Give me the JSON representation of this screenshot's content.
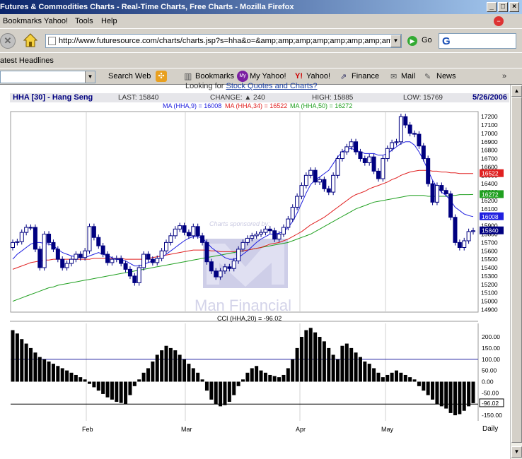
{
  "window": {
    "title": "Futures & Commodities Charts - Real-Time Charts, Free Charts - Mozilla Firefox",
    "buttons": [
      "_",
      "□",
      "×"
    ]
  },
  "menu": [
    "Bookmarks",
    "Yahoo!",
    "Tools",
    "Help"
  ],
  "nav": {
    "url": "http://www.futuresource.com/charts/charts.jsp?s=hha&o=&amp;amp;amp;amp;amp;amp;amp;amp;amp;a=D",
    "go_label": "Go",
    "search_logo": "G"
  },
  "headlines_label": "atest Headlines",
  "yahoo_toolbar": {
    "search_web": "Search Web",
    "bookmarks": "Bookmarks",
    "my_yahoo": "My Yahoo!",
    "yahoo": "Yahoo!",
    "finance": "Finance",
    "mail": "Mail",
    "news": "News"
  },
  "page": {
    "promo": "Looking for Stock Quotes and Charts?",
    "promo_link": "Stock Quotes and Charts?",
    "symbol": "HHA [30] - Hang Seng",
    "last": "LAST: 15840",
    "change": "CHANGE: ▲ 240",
    "high": "HIGH: 15885",
    "low": "LOW: 15769",
    "date": "5/26/2006",
    "ma_line": [
      "MA (HHA,9) = 16008",
      "MA (HHA,34) = 16522",
      "MA (HHA,50) = 16272"
    ],
    "cci_title": "CCI (HHA,20) = -96.02",
    "watermark_sponsor": "Charts sponsored by:",
    "watermark_brand": "Man Financial",
    "period": "Daily"
  },
  "colors": {
    "ma9": "#2020e0",
    "ma34": "#e02020",
    "ma50": "#20a020",
    "candle": "#000080",
    "cci": "#000000"
  },
  "chart_data": [
    {
      "type": "candlestick",
      "title": "HHA [30] - Hang Seng",
      "x_labels": [
        "Feb",
        "Mar",
        "Apr",
        "May"
      ],
      "y_ticks": [
        17200,
        17100,
        17000,
        16900,
        16800,
        16700,
        16600,
        16500,
        16400,
        16300,
        16200,
        16100,
        16000,
        15900,
        15800,
        15700,
        15600,
        15500,
        15400,
        15300,
        15200,
        15100,
        15000,
        14900
      ],
      "ylim": [
        14870,
        17260
      ],
      "price_tags": [
        {
          "name": "MA34",
          "value": 16522,
          "color": "#e02020"
        },
        {
          "name": "MA50",
          "value": 16272,
          "color": "#20a020"
        },
        {
          "name": "MA9",
          "value": 16008,
          "color": "#2020e0"
        },
        {
          "name": "Last",
          "value": 15840,
          "color": "#000080"
        }
      ],
      "closes": [
        15700,
        15710,
        15820,
        15880,
        15880,
        15620,
        15400,
        15800,
        15700,
        15620,
        15500,
        15400,
        15450,
        15500,
        15560,
        15520,
        15600,
        15890,
        15760,
        15660,
        15560,
        15460,
        15500,
        15510,
        15450,
        15380,
        15300,
        15220,
        15400,
        15560,
        15500,
        15460,
        15510,
        15600,
        15700,
        15780,
        15860,
        15900,
        15820,
        15780,
        15890,
        15780,
        15700,
        15470,
        15360,
        15290,
        15360,
        15410,
        15390,
        15480,
        15620,
        15700,
        15750,
        15780,
        15800,
        15820,
        15860,
        15840,
        15740,
        15800,
        15880,
        15980,
        16120,
        16250,
        16380,
        16500,
        16560,
        16420,
        16450,
        16340,
        16300,
        16500,
        16700,
        16780,
        16840,
        16900,
        16780,
        16700,
        16650,
        16720,
        16550,
        16460,
        16700,
        16820,
        16890,
        16900,
        17200,
        17100,
        17000,
        16990,
        16850,
        16700,
        16400,
        16180,
        16380,
        16320,
        16280,
        16000,
        15700,
        15640,
        15720,
        15830,
        15840
      ],
      "ma9": [
        15500,
        15560,
        15600,
        15640,
        15680,
        15700,
        15700,
        15690,
        15680,
        15660,
        15620,
        15580,
        15560,
        15540,
        15530,
        15520,
        15520,
        15540,
        15560,
        15580,
        15560,
        15540,
        15520,
        15500,
        15490,
        15480,
        15450,
        15420,
        15420,
        15440,
        15460,
        15480,
        15500,
        15520,
        15560,
        15600,
        15640,
        15680,
        15720,
        15750,
        15770,
        15770,
        15750,
        15700,
        15640,
        15600,
        15560,
        15520,
        15500,
        15500,
        15520,
        15560,
        15600,
        15650,
        15700,
        15740,
        15770,
        15800,
        15800,
        15810,
        15830,
        15880,
        15950,
        16050,
        16170,
        16290,
        16390,
        16450,
        16480,
        16520,
        16560,
        16640,
        16720,
        16780,
        16810,
        16820,
        16800,
        16780,
        16760,
        16760,
        16760,
        16740,
        16740,
        16760,
        16800,
        16840,
        16880,
        16900,
        16900,
        16860,
        16780,
        16680,
        16560,
        16440,
        16360,
        16300,
        16260,
        16200,
        16120,
        16080,
        16040,
        16020,
        16008
      ],
      "ma34": [
        15380,
        15400,
        15420,
        15440,
        15460,
        15470,
        15480,
        15490,
        15490,
        15500,
        15500,
        15500,
        15500,
        15500,
        15500,
        15500,
        15500,
        15500,
        15510,
        15510,
        15510,
        15510,
        15510,
        15510,
        15510,
        15500,
        15500,
        15500,
        15500,
        15500,
        15510,
        15520,
        15530,
        15540,
        15550,
        15560,
        15570,
        15580,
        15590,
        15600,
        15610,
        15610,
        15610,
        15610,
        15600,
        15600,
        15590,
        15590,
        15590,
        15590,
        15600,
        15600,
        15610,
        15620,
        15630,
        15640,
        15660,
        15680,
        15690,
        15700,
        15720,
        15740,
        15770,
        15800,
        15830,
        15870,
        15910,
        15940,
        15970,
        16000,
        16040,
        16080,
        16120,
        16160,
        16200,
        16240,
        16270,
        16290,
        16310,
        16340,
        16360,
        16380,
        16400,
        16420,
        16450,
        16470,
        16500,
        16520,
        16540,
        16550,
        16560,
        16560,
        16560,
        16550,
        16550,
        16540,
        16540,
        16530,
        16530,
        16522,
        16522,
        16522,
        16522
      ],
      "ma50": [
        15000,
        15020,
        15040,
        15060,
        15080,
        15100,
        15120,
        15140,
        15160,
        15170,
        15190,
        15200,
        15210,
        15220,
        15230,
        15240,
        15250,
        15260,
        15270,
        15280,
        15290,
        15300,
        15310,
        15320,
        15330,
        15340,
        15350,
        15360,
        15370,
        15380,
        15390,
        15400,
        15410,
        15420,
        15430,
        15440,
        15450,
        15460,
        15470,
        15480,
        15490,
        15500,
        15510,
        15520,
        15530,
        15540,
        15550,
        15560,
        15570,
        15580,
        15590,
        15600,
        15610,
        15620,
        15630,
        15640,
        15650,
        15660,
        15670,
        15680,
        15690,
        15700,
        15720,
        15740,
        15760,
        15780,
        15800,
        15830,
        15860,
        15890,
        15920,
        15950,
        15980,
        16010,
        16040,
        16070,
        16100,
        16120,
        16140,
        16160,
        16180,
        16190,
        16200,
        16210,
        16220,
        16230,
        16240,
        16250,
        16260,
        16260,
        16260,
        16260,
        16250,
        16250,
        16250,
        16250,
        16250,
        16260,
        16260,
        16270,
        16270,
        16270,
        16272
      ]
    },
    {
      "type": "bar",
      "title": "CCI (HHA,20) = -96.02",
      "y_ticks": [
        200,
        150,
        100,
        50,
        0,
        -50,
        -100,
        -150
      ],
      "y_tick_labels": [
        "200.00",
        "150.00",
        "100.00",
        "50.00",
        "0.00",
        "-50.00",
        "-100.00",
        "-150.00"
      ],
      "ylim": [
        -175,
        260
      ],
      "reference_lines": [
        100,
        -100
      ],
      "last_value_tag": "-96.02",
      "values": [
        230,
        215,
        190,
        170,
        150,
        130,
        110,
        100,
        90,
        80,
        70,
        60,
        50,
        40,
        30,
        20,
        10,
        -10,
        -25,
        -40,
        -55,
        -70,
        -80,
        -90,
        -95,
        -100,
        -60,
        -20,
        10,
        40,
        60,
        90,
        120,
        140,
        160,
        150,
        140,
        120,
        100,
        80,
        60,
        40,
        10,
        -40,
        -80,
        -100,
        -110,
        -105,
        -90,
        -60,
        -20,
        10,
        40,
        60,
        70,
        50,
        40,
        30,
        25,
        20,
        30,
        60,
        100,
        150,
        200,
        230,
        240,
        220,
        200,
        180,
        150,
        120,
        100,
        160,
        170,
        150,
        130,
        110,
        90,
        80,
        60,
        40,
        20,
        30,
        40,
        50,
        40,
        30,
        20,
        10,
        -20,
        -40,
        -60,
        -80,
        -100,
        -110,
        -120,
        -140,
        -150,
        -145,
        -130,
        -110,
        -96
      ]
    }
  ]
}
